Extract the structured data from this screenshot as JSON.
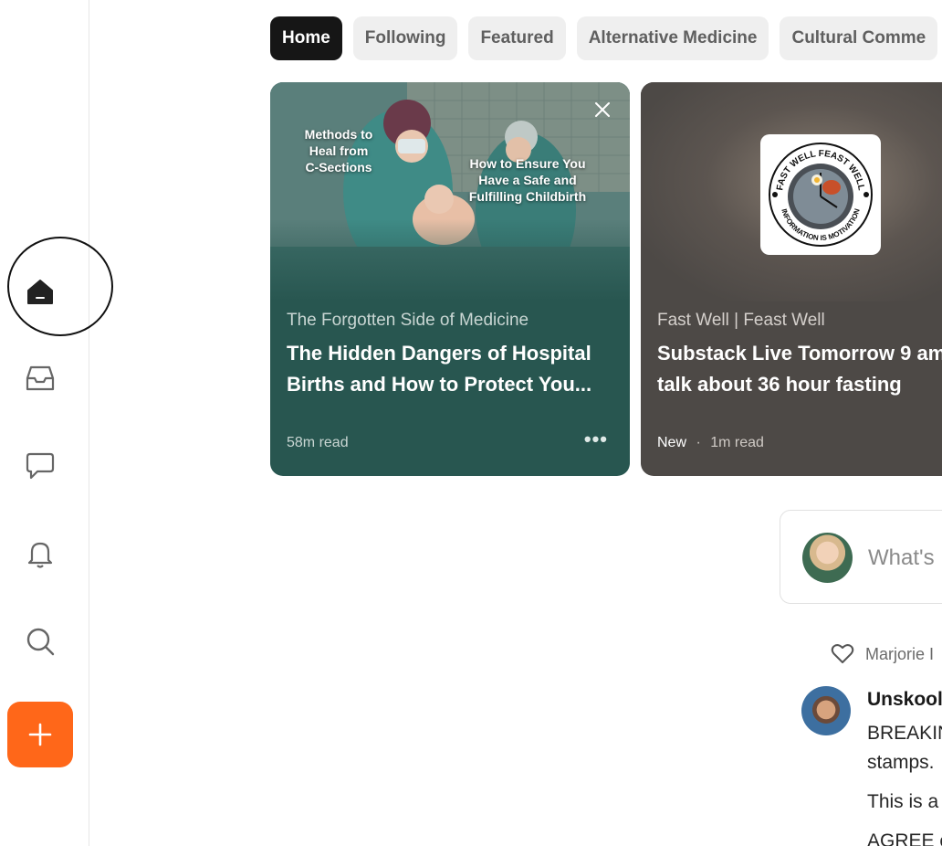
{
  "sidebar": {
    "items": [
      {
        "name": "home-icon"
      },
      {
        "name": "inbox-icon"
      },
      {
        "name": "chat-icon"
      },
      {
        "name": "bell-icon"
      },
      {
        "name": "search-icon"
      }
    ],
    "create_icon": "plus-icon",
    "accent": "#ff6719"
  },
  "tabs": [
    {
      "label": "Home"
    },
    {
      "label": "Following"
    },
    {
      "label": "Featured"
    },
    {
      "label": "Alternative Medicine"
    },
    {
      "label": "Cultural Comme"
    }
  ],
  "cards": [
    {
      "image_text_left": [
        "Methods to",
        "Heal from",
        "C-Sections"
      ],
      "image_text_right": [
        "How to Ensure You",
        "Have a Safe and",
        "Fulfilling Childbirth"
      ],
      "publication": "The Forgotten Side of Medicine",
      "title_line1": "The Hidden Dangers of Hospital",
      "title_line2": "Births and How to Protect You...",
      "read_time": "58m read",
      "more_icon": "ellipsis-icon",
      "close_icon": "close-icon",
      "color": "#285650"
    },
    {
      "logo_text_top": "FAST WELL FEAST WELL",
      "logo_text_bottom": "INFORMATION IS MOTIVATION",
      "publication": "Fast Well | Feast Well",
      "title_line1": "Substack Live Tomorrow 9 am",
      "title_line2": "talk about 36 hour fasting",
      "badge": "New",
      "separator": "·",
      "read_time": "1m read",
      "color": "#4d4946"
    }
  ],
  "composer": {
    "placeholder": "What's"
  },
  "feed": {
    "liked_by": "Marjorie I",
    "post": {
      "author": "Unskool",
      "lines": [
        "BREAKIN",
        "stamps.",
        "This is a",
        "AGREE c"
      ]
    }
  }
}
